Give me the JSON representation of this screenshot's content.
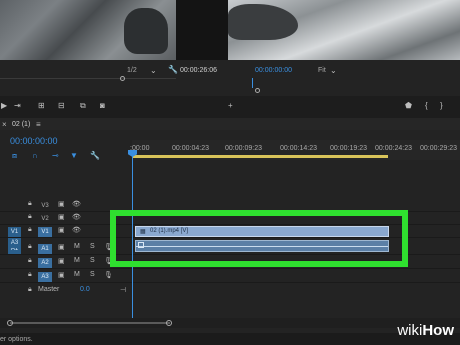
{
  "monitors": {
    "source_resolution": "1/2",
    "source_timecode": "00:00:26:06",
    "program_timecode": "00:00:00:00",
    "program_fit": "Fit"
  },
  "sequence": {
    "tab_name": "02 (1)",
    "timecode": "00:00:00:00"
  },
  "ruler": {
    "ticks": [
      ":00:00",
      "00:00:04:23",
      "00:00:09:23",
      "00:00:14:23",
      "00:00:19:23",
      "00:00:24:23",
      "00:00:29:23"
    ]
  },
  "tracks": {
    "video": [
      {
        "name": "V3",
        "patch": ""
      },
      {
        "name": "V2",
        "patch": ""
      },
      {
        "name": "V1",
        "patch": "V1"
      }
    ],
    "audio": [
      {
        "name": "A1",
        "patch": "A1",
        "m": "M",
        "s": "S"
      },
      {
        "name": "A2",
        "patch": "",
        "m": "M",
        "s": "S"
      },
      {
        "name": "A3",
        "patch": "",
        "m": "M",
        "s": "S"
      }
    ],
    "master_label": "Master",
    "master_value": "0.0"
  },
  "clip": {
    "video_label": "02 (1).mp4 [V]"
  },
  "status": {
    "text": "er options."
  },
  "watermark": {
    "wiki": "wiki",
    "how": "How"
  }
}
